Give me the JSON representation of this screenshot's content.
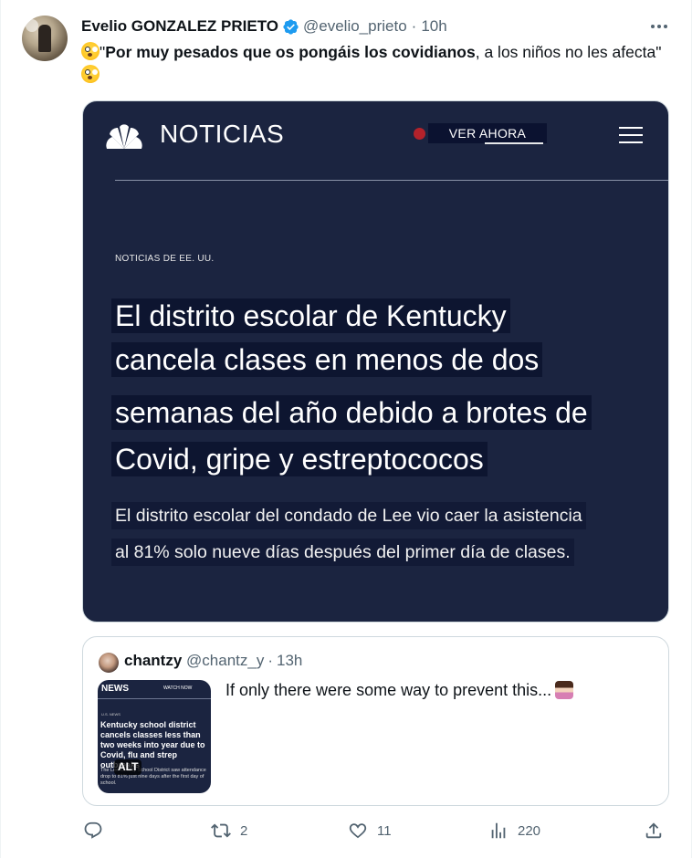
{
  "tweet": {
    "author_name": "Evelio GONZALEZ PRIETO",
    "handle": "@evelio_prieto",
    "separator": "·",
    "time": "10h",
    "text_quote_open": "\"",
    "text_bold": "Por muy pesados que os pongáis los covidianos",
    "text_rest": ", a los niños no les afecta\"",
    "emoji_icon": "flushed-face-emoji"
  },
  "media": {
    "brand": "NOTICIAS",
    "watch_label": "VER AHORA",
    "kicker": "NOTICIAS DE EE. UU.",
    "headline_lines": [
      "El distrito escolar de Kentucky",
      "cancela clases en menos de dos",
      "semanas del año debido a brotes de",
      "Covid, gripe y estreptococos"
    ],
    "sub_lines": [
      "El distrito escolar del condado de Lee vio caer la asistencia",
      "al 81% solo nueve días después del primer día de clases."
    ]
  },
  "quote": {
    "author_name": "chantzy",
    "handle": "@chantz_y",
    "separator": "·",
    "time": "13h",
    "text": "If only there were some way to prevent this...",
    "thumb_brand": "NEWS",
    "thumb_watch": "WATCH NOW",
    "thumb_kicker": "U.S. NEWS",
    "thumb_headline": "Kentucky school district cancels classes less than two weeks into year due to Covid, flu and strep outbreaks",
    "thumb_sub": "The Lee County School District saw attendance drop to 81% just nine days after the first day of school.",
    "alt_badge": "ALT"
  },
  "actions": {
    "reply_count": "",
    "retweet_count": "2",
    "like_count": "11",
    "views_count": "220"
  }
}
